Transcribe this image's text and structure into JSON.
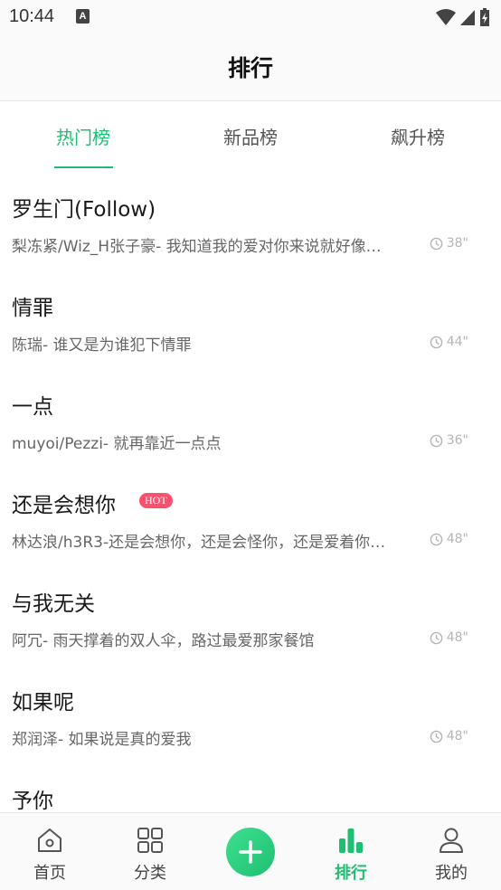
{
  "status_bar": {
    "time": "10:44",
    "notification_icon": "A"
  },
  "header": {
    "title": "排行"
  },
  "tabs": [
    {
      "label": "热门榜",
      "active": true
    },
    {
      "label": "新品榜",
      "active": false
    },
    {
      "label": "飙升榜",
      "active": false
    }
  ],
  "songs": [
    {
      "title": "罗生门(Follow)",
      "subtitle": "梨冻紧/Wiz_H张子豪- 我知道我的爱对你来说就好像…",
      "duration": "38\"",
      "hot": false
    },
    {
      "title": "情罪",
      "subtitle": "陈瑞- 谁又是为谁犯下情罪",
      "duration": "44\"",
      "hot": false
    },
    {
      "title": "一点",
      "subtitle": "muyoi/Pezzi- 就再靠近一点点",
      "duration": "36\"",
      "hot": false
    },
    {
      "title": "还是会想你",
      "subtitle": "林达浪/h3R3-还是会想你，还是会怪你，还是爱着你…",
      "duration": "48\"",
      "hot": true,
      "badge": "HOT"
    },
    {
      "title": "与我无关",
      "subtitle": "阿冗- 雨天撑着的双人伞，路过最爱那家餐馆",
      "duration": "48\"",
      "hot": false
    },
    {
      "title": "如果呢",
      "subtitle": "郑润泽- 如果说是真的爱我",
      "duration": "48\"",
      "hot": false
    },
    {
      "title": "予你",
      "subtitle": "",
      "duration": "",
      "hot": false
    }
  ],
  "bottom_nav": {
    "home": "首页",
    "category": "分类",
    "ranking": "排行",
    "mine": "我的"
  },
  "colors": {
    "accent": "#1fbf73",
    "hot_badge": "#ff4f6e"
  }
}
